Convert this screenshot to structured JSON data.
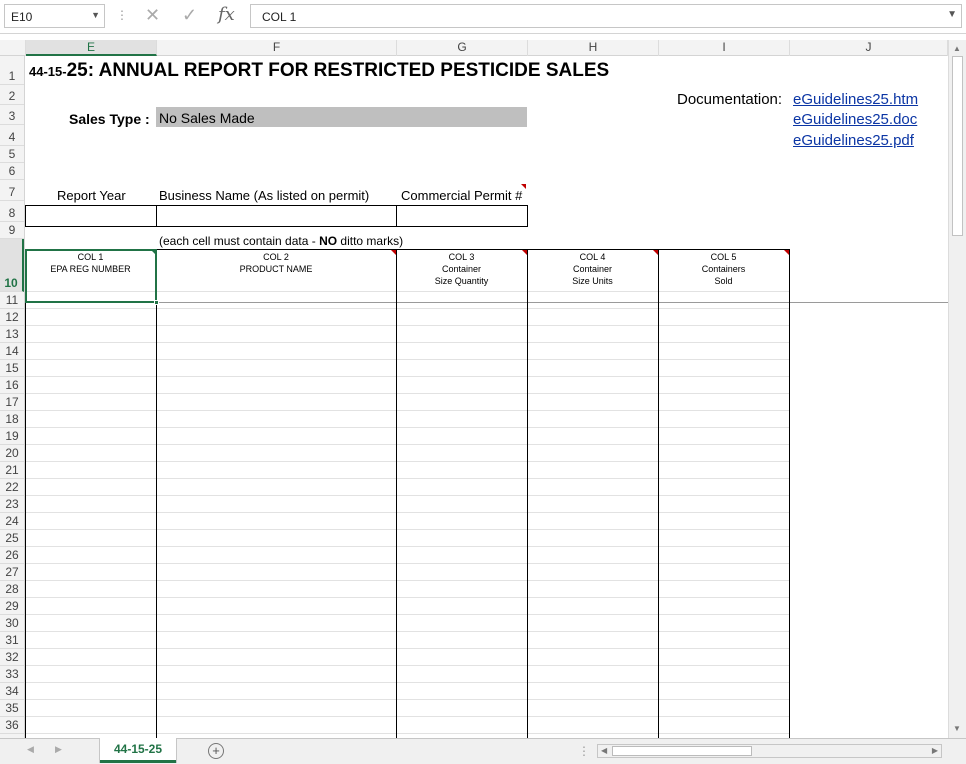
{
  "formula_bar": {
    "name_box": "E10",
    "content": "COL 1",
    "fx": "fx"
  },
  "columns": [
    "E",
    "F",
    "G",
    "H",
    "I",
    "J"
  ],
  "rows": [
    "1",
    "2",
    "3",
    "4",
    "5",
    "6",
    "7",
    "8",
    "9",
    "10",
    "11",
    "12",
    "13",
    "14",
    "15",
    "16",
    "17",
    "18",
    "19",
    "20",
    "21",
    "22",
    "23",
    "24",
    "25",
    "26",
    "27",
    "28",
    "29",
    "30",
    "31",
    "32",
    "33",
    "34",
    "35",
    "36"
  ],
  "sheet": {
    "title_prefix": "44-15-",
    "title_main": "25: ANNUAL REPORT FOR RESTRICTED PESTICIDE SALES",
    "documentation_label": "Documentation:",
    "links": [
      "eGuidelines25.htm",
      "eGuidelines25.doc",
      "eGuidelines25.pdf"
    ],
    "sales_type_label": "Sales Type :",
    "sales_type_value": "No Sales Made",
    "report_year_label": "Report Year",
    "business_name_label": "Business Name (As listed on permit)",
    "commercial_permit_label": "Commercial Permit #",
    "note_prefix": "(each cell must contain data - ",
    "note_bold": "NO",
    "note_suffix": " ditto marks)",
    "table_headers": [
      {
        "line1": "COL 1",
        "line2": "EPA REG NUMBER",
        "line3": ""
      },
      {
        "line1": "COL 2",
        "line2": "PRODUCT NAME",
        "line3": ""
      },
      {
        "line1": "COL 3",
        "line2": "Container",
        "line3": "Size Quantity"
      },
      {
        "line1": "COL 4",
        "line2": "Container",
        "line3": "Size Units"
      },
      {
        "line1": "COL 5",
        "line2": "Containers",
        "line3": "Sold"
      }
    ]
  },
  "tabs": {
    "active": "44-15-25"
  },
  "colors": {
    "accent": "#217346",
    "link": "#0b35a4",
    "shaded_cell": "#bfbfbf",
    "note_flag": "#c00000"
  }
}
